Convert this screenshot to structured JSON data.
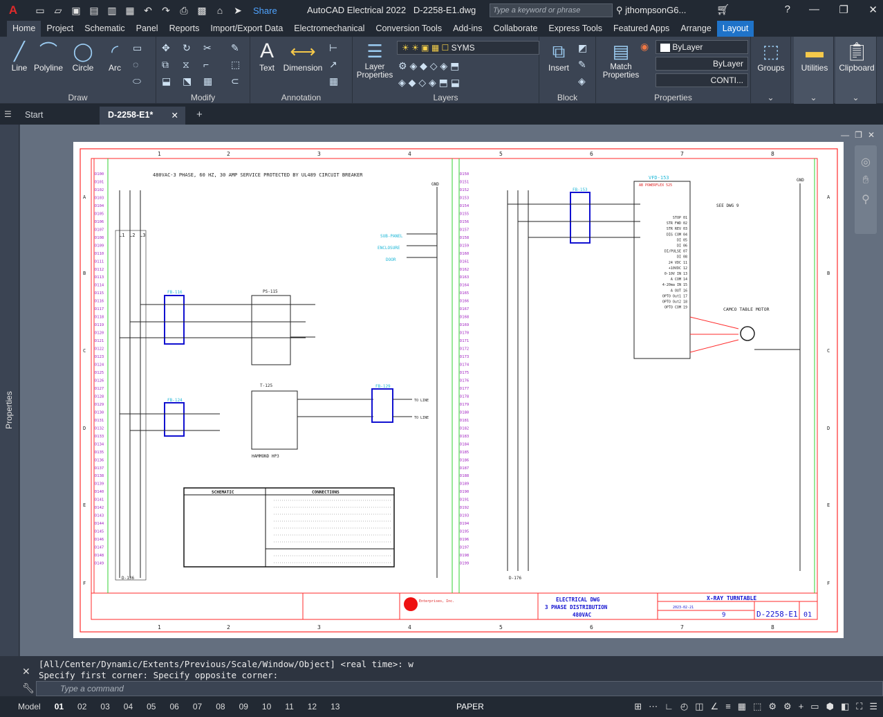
{
  "app": {
    "logo": "A",
    "title": "AutoCAD Electrical 2022",
    "filename": "D-2258-E1.dwg",
    "share": "Share",
    "search_placeholder": "Type a keyword or phrase",
    "user": "jthompsonG6...",
    "help": "?"
  },
  "menu": [
    "Home",
    "Project",
    "Schematic",
    "Panel",
    "Reports",
    "Import/Export Data",
    "Electromechanical",
    "Conversion Tools",
    "Add-ins",
    "Collaborate",
    "Express Tools",
    "Featured Apps",
    "Arrange",
    "Layout"
  ],
  "ribbon": {
    "draw": {
      "title": "Draw",
      "tools": [
        "Line",
        "Polyline",
        "Circle",
        "Arc"
      ]
    },
    "modify": {
      "title": "Modify"
    },
    "annotation": {
      "title": "Annotation",
      "tools": [
        "Text",
        "Dimension"
      ]
    },
    "layers": {
      "title": "Layers",
      "tool": "Layer Properties",
      "layer_name": "SYMS"
    },
    "block": {
      "title": "Block",
      "tool": "Insert"
    },
    "properties": {
      "title": "Properties",
      "tool": "Match Properties",
      "color": "ByLayer",
      "lineweight": "ByLayer",
      "linetype": "CONTI..."
    },
    "groups": "Groups",
    "utilities": "Utilities",
    "clipboard": "Clipboard"
  },
  "doc_tabs": {
    "start": "Start",
    "active": "D-2258-E1*"
  },
  "sidebar_label": "Properties",
  "drawing": {
    "service_note": "480VAC-3 PHASE, 60 HZ, 30 AMP SERVICE PROTECTED BY UL489 CIRCUIT BREAKER",
    "gnd": "GND",
    "col_numbers": [
      "1",
      "2",
      "3",
      "4",
      "5",
      "6",
      "7",
      "8"
    ],
    "row_letters": [
      "A",
      "B",
      "C",
      "D",
      "E",
      "F"
    ],
    "left_rungs": [
      "D100",
      "D101",
      "D102",
      "D103",
      "D104",
      "D105",
      "D106",
      "D107",
      "D108",
      "D109",
      "D110",
      "D111",
      "D112",
      "D113",
      "D114",
      "D115",
      "D116",
      "D117",
      "D118",
      "D119",
      "D120",
      "D121",
      "D122",
      "D123",
      "D124",
      "D125",
      "D126",
      "D127",
      "D128",
      "D129",
      "D130",
      "D131",
      "D132",
      "D133",
      "D134",
      "D135",
      "D136",
      "D137",
      "D138",
      "D139",
      "D140",
      "D141",
      "D142",
      "D143",
      "D144",
      "D145",
      "D146",
      "D147",
      "D148",
      "D149"
    ],
    "right_rungs": [
      "D150",
      "D151",
      "D152",
      "D153",
      "D154",
      "D155",
      "D156",
      "D157",
      "D158",
      "D159",
      "D160",
      "D161",
      "D162",
      "D163",
      "D164",
      "D165",
      "D166",
      "D167",
      "D168",
      "D169",
      "D170",
      "D171",
      "D172",
      "D173",
      "D174",
      "D175",
      "D176",
      "D177",
      "D178",
      "D179",
      "D180",
      "D181",
      "D182",
      "D183",
      "D184",
      "D185",
      "D186",
      "D187",
      "D188",
      "D189",
      "D190",
      "D191",
      "D192",
      "D193",
      "D194",
      "D195",
      "D196",
      "D197",
      "D198",
      "D199"
    ],
    "labels": {
      "fb116": "FB-116",
      "fb124": "FB-124",
      "fb129": "FB-129",
      "fb153": "FB-153",
      "ps115": "PS-115",
      "t125": "T-125",
      "vfd": "VFD-153",
      "vfd_sub": "AB POWERFLEX 525",
      "see_dwg": "SEE DWG 9",
      "motor": "CAMCO TABLE MOTOR",
      "subpanel": "SUB-PANEL",
      "enclosure": "ENCLOSURE",
      "door": "DOOR",
      "hammond": "HAMMOND HP3",
      "to_line": "TO LINE",
      "schematic": "SCHEMATIC",
      "connections": "CONNECTIONS",
      "l1l2l3": [
        "L1",
        "L2",
        "L3"
      ],
      "wires_blk": "BLK",
      "ref_left": "D-136",
      "ref_right": "D-176"
    },
    "vfd_terminals": [
      "STOP 01",
      "STR FWD 02",
      "STR REV 03",
      "DIG COM 04",
      "DI 05",
      "DI 06",
      "DI/PULSE 07",
      "DI 08",
      "24 VDC 11",
      "+10VDC 12",
      "0-10V IN 13",
      "A COM 14",
      "4-20ma IN 15",
      "A OUT 16",
      "OPTO Out1 17",
      "OPTO Out2 18",
      "OPTO COM 19"
    ],
    "title_block": {
      "dwg_line1": "ELECTRICAL DWG",
      "dwg_line2": "3 PHASE DISTRIBUTION",
      "dwg_line3": "480VAC",
      "project": "X-RAY TURNTABLE",
      "dwg_no": "D-2258-E1",
      "rev": "01",
      "sheet": "9",
      "company": "Enterprises, Inc.",
      "date": "2023-02-21"
    }
  },
  "command": {
    "history1": "[All/Center/Dynamic/Extents/Previous/Scale/Window/Object] <real time>: w",
    "history2": "Specify first corner: Specify opposite corner:",
    "placeholder": "Type a command"
  },
  "status": {
    "tabs": [
      "Model",
      "01",
      "02",
      "03",
      "04",
      "05",
      "06",
      "07",
      "08",
      "09",
      "10",
      "11",
      "12",
      "13"
    ],
    "space": "PAPER"
  }
}
